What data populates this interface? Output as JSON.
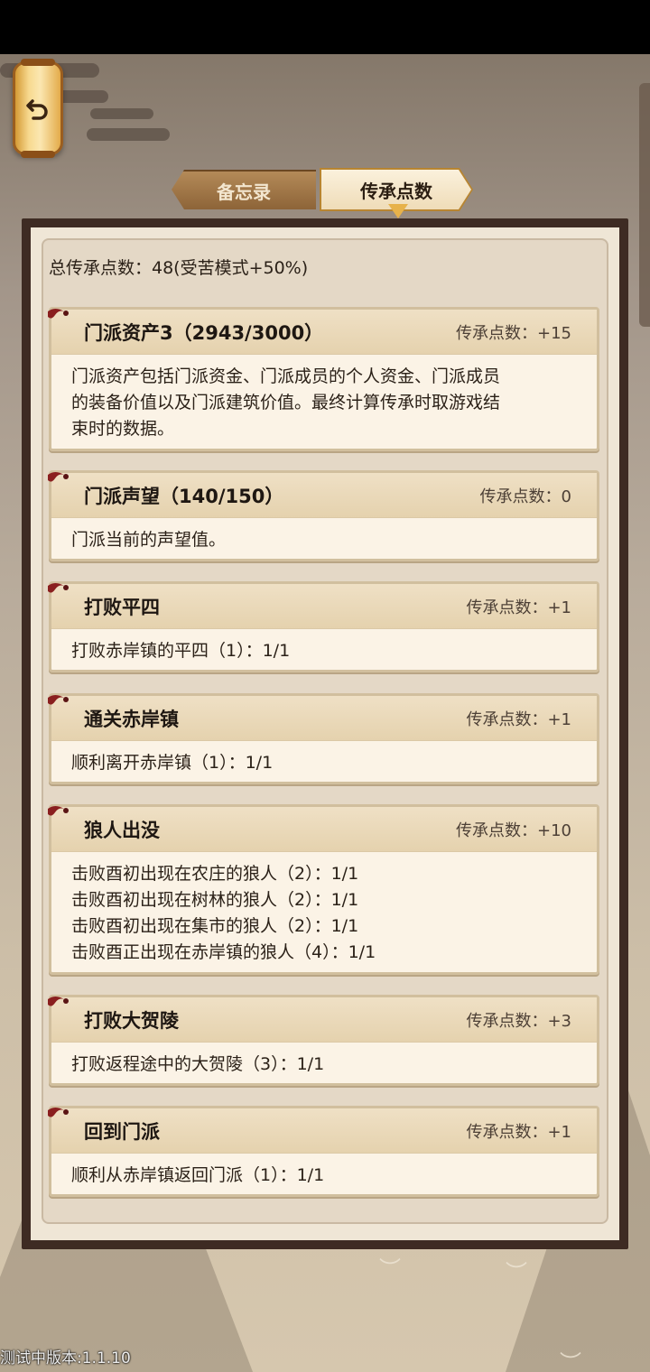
{
  "tabs": [
    {
      "label": "备忘录",
      "active": false
    },
    {
      "label": "传承点数",
      "active": true
    }
  ],
  "total_label": "总传承点数：48(受苦模式+50%)",
  "cards": [
    {
      "title": "门派资产3（2943/3000）",
      "points": "传承点数：+15",
      "lines": [
        "门派资产包括门派资金、门派成员的个人资金、门派成员",
        "的装备价值以及门派建筑价值。最终计算传承时取游戏结",
        "束时的数据。"
      ]
    },
    {
      "title": "门派声望（140/150）",
      "points": "传承点数：0",
      "lines": [
        "门派当前的声望值。"
      ]
    },
    {
      "title": "打败平四",
      "points": "传承点数：+1",
      "lines": [
        "打败赤岸镇的平四（1）：1/1"
      ]
    },
    {
      "title": "通关赤岸镇",
      "points": "传承点数：+1",
      "lines": [
        "顺利离开赤岸镇（1）：1/1"
      ]
    },
    {
      "title": "狼人出没",
      "points": "传承点数：+10",
      "lines": [
        "击败酉初出现在农庄的狼人（2）：1/1",
        "击败酉初出现在树林的狼人（2）：1/1",
        "击败酉初出现在集市的狼人（2）：1/1",
        "击败酉正出现在赤岸镇的狼人（4）：1/1"
      ]
    },
    {
      "title": "打败大贺陵",
      "points": "传承点数：+3",
      "lines": [
        "打败返程途中的大贺陵（3）：1/1"
      ]
    },
    {
      "title": "回到门派",
      "points": "传承点数：+1",
      "lines": [
        "顺利从赤岸镇返回门派（1）：1/1"
      ]
    }
  ],
  "icons": {
    "back": "back-arrow-icon",
    "tassel": "tassel-icon"
  },
  "version": "测试中版本:1.1.10"
}
